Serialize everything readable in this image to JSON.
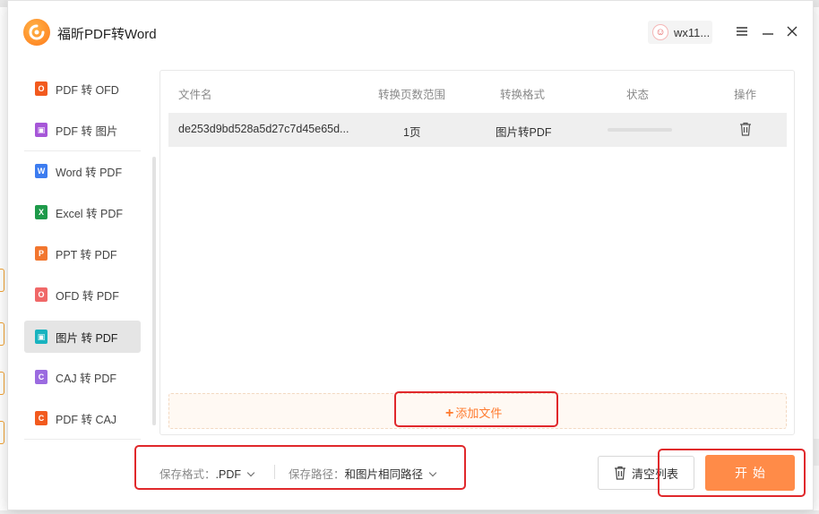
{
  "app": {
    "title": "福昕PDF转Word",
    "user": "wx11..."
  },
  "sidebar": {
    "items": [
      {
        "label": "PDF 转 OFD",
        "icon": "ofd-icon",
        "color": "#f25a1e",
        "glyph": "O"
      },
      {
        "label": "PDF 转 图片",
        "icon": "image-icon",
        "color": "#a656d8",
        "glyph": "▣"
      },
      {
        "label": "Word 转 PDF",
        "icon": "word-icon",
        "color": "#3c7cf0",
        "glyph": "W"
      },
      {
        "label": "Excel 转 PDF",
        "icon": "excel-icon",
        "color": "#1e9a4a",
        "glyph": "X"
      },
      {
        "label": "PPT 转 PDF",
        "icon": "ppt-icon",
        "color": "#f2762e",
        "glyph": "P"
      },
      {
        "label": "OFD 转 PDF",
        "icon": "ofd-pdf-icon",
        "color": "#f06868",
        "glyph": "O"
      },
      {
        "label": "图片 转 PDF",
        "icon": "image-pdf-icon",
        "color": "#18b3bf",
        "glyph": "▣"
      },
      {
        "label": "CAJ 转 PDF",
        "icon": "caj-icon",
        "color": "#9b6be0",
        "glyph": "C"
      },
      {
        "label": "PDF 转 CAJ",
        "icon": "pdf-caj-icon",
        "color": "#f25a1e",
        "glyph": "C"
      }
    ],
    "active_index": 6
  },
  "table": {
    "headers": {
      "name": "文件名",
      "range": "转换页数范围",
      "format": "转换格式",
      "status": "状态",
      "action": "操作"
    },
    "rows": [
      {
        "name": "de253d9bd528a5d27c7d45e65d...",
        "range": "1页",
        "format": "图片转PDF",
        "progress": 0
      }
    ]
  },
  "add_file": {
    "label": "添加文件"
  },
  "footer": {
    "format_label": "保存格式：",
    "format_value": ".PDF",
    "path_label": "保存路径：",
    "path_value": "和图片相同路径",
    "clear_label": "清空列表",
    "start_label": "开始"
  },
  "colors": {
    "accent": "#ff8b48",
    "highlight": "#e0282b"
  }
}
